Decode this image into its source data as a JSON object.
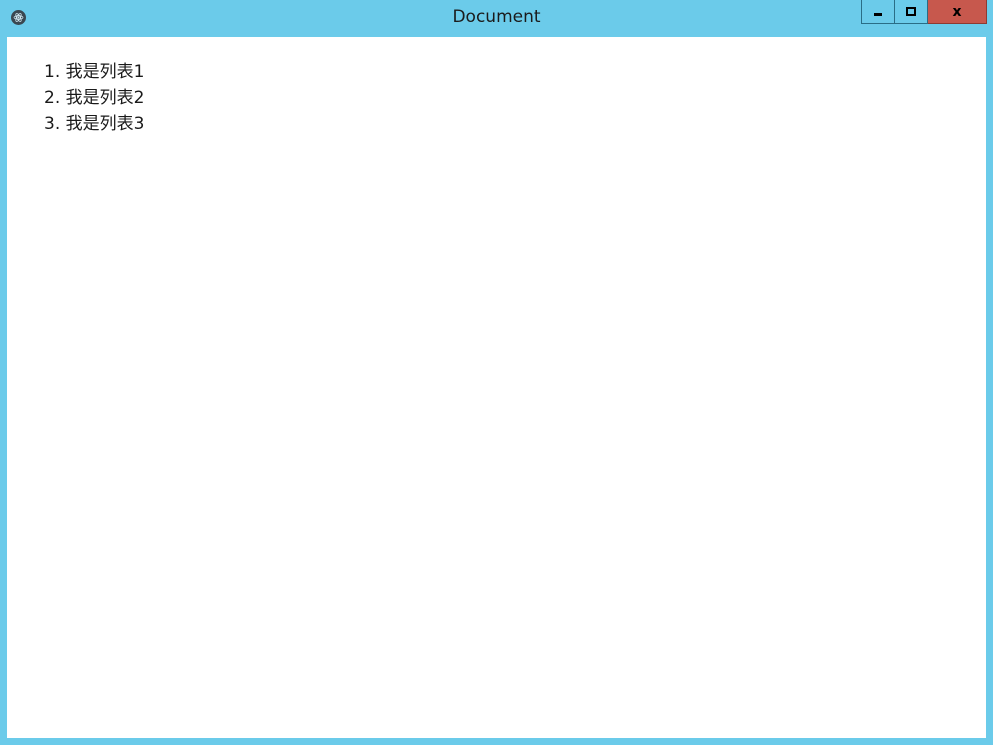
{
  "window": {
    "title": "Document",
    "controls": {
      "minimize_icon": "minimize-icon",
      "maximize_icon": "maximize-icon",
      "close_label": "x"
    },
    "colors": {
      "frame": "#6bcbea",
      "close": "#c7584d",
      "content_bg": "#ffffff"
    }
  },
  "content": {
    "list": [
      {
        "marker": "1.",
        "text": "我是列表1"
      },
      {
        "marker": "2.",
        "text": "我是列表2"
      },
      {
        "marker": "3.",
        "text": "我是列表3"
      }
    ]
  }
}
